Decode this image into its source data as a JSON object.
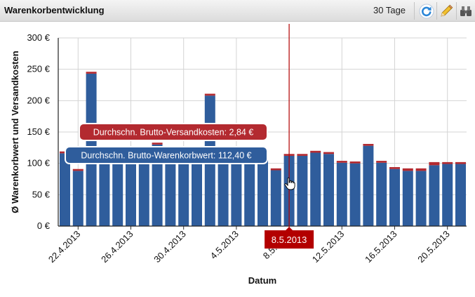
{
  "header": {
    "title": "Warenkorbentwicklung",
    "range_label": "30 Tage",
    "icons": [
      "refresh-icon",
      "pencil-icon",
      "binoculars-icon"
    ]
  },
  "colors": {
    "bar_main": "#2f5d9c",
    "bar_top": "#b32a30",
    "tooltip_blue": "#2f5d9c",
    "tooltip_red": "#b32a30",
    "crosshair": "#b30000",
    "refresh_icon": "#2a86d8",
    "pencil_icon": "#e8b020"
  },
  "chart_data": {
    "type": "bar",
    "stacked": true,
    "xlabel": "Datum",
    "ylabel": "Ø Warenkorbwert und Versandkosten",
    "ylim": [
      0,
      300
    ],
    "yticks": [
      0,
      50,
      100,
      150,
      200,
      250,
      300
    ],
    "ytick_labels": [
      "0 €",
      "50 €",
      "100 €",
      "150 €",
      "200 €",
      "250 €",
      "300 €"
    ],
    "grid": true,
    "categories": [
      "21.4.2013",
      "22.4.2013",
      "23.4.2013",
      "24.4.2013",
      "25.4.2013",
      "26.4.2013",
      "27.4.2013",
      "28.4.2013",
      "29.4.2013",
      "30.4.2013",
      "1.5.2013",
      "2.5.2013",
      "3.5.2013",
      "4.5.2013",
      "5.5.2013",
      "6.5.2013",
      "7.5.2013",
      "8.5.2013",
      "9.5.2013",
      "10.5.2013",
      "11.5.2013",
      "12.5.2013",
      "13.5.2013",
      "14.5.2013",
      "15.5.2013",
      "16.5.2013",
      "17.5.2013",
      "18.5.2013",
      "19.5.2013",
      "20.5.2013",
      "21.5.2013"
    ],
    "xtick_labels": [
      "22.4.2013",
      "26.4.2013",
      "30.4.2013",
      "4.5.2013",
      "8.5.2013",
      "12.5.2013",
      "16.5.2013",
      "20.5.2013"
    ],
    "series": [
      {
        "name": "Durchschn. Brutto-Warenkorbwert",
        "values": [
          116,
          88,
          243,
          110,
          112,
          108,
          110,
          130,
          112,
          108,
          110,
          208,
          110,
          108,
          110,
          112.4,
          89,
          112,
          112,
          117,
          115,
          101,
          100,
          128,
          101,
          91,
          88,
          88,
          97,
          99,
          99
        ]
      },
      {
        "name": "Durchschn. Brutto-Versandkosten",
        "values": [
          3,
          3,
          3,
          3,
          3,
          3,
          3,
          3,
          3,
          3,
          3,
          3,
          3,
          3,
          3,
          2.84,
          3,
          3,
          3,
          3,
          3,
          3,
          3,
          3,
          3,
          3,
          4,
          4,
          5,
          3,
          3
        ]
      }
    ],
    "hover": {
      "date": "8.5.2013",
      "tooltips": [
        "Durchschn. Brutto-Versandkosten: 2,84 €",
        "Durchschn. Brutto-Warenkorbwert: 112,40 €"
      ]
    }
  }
}
